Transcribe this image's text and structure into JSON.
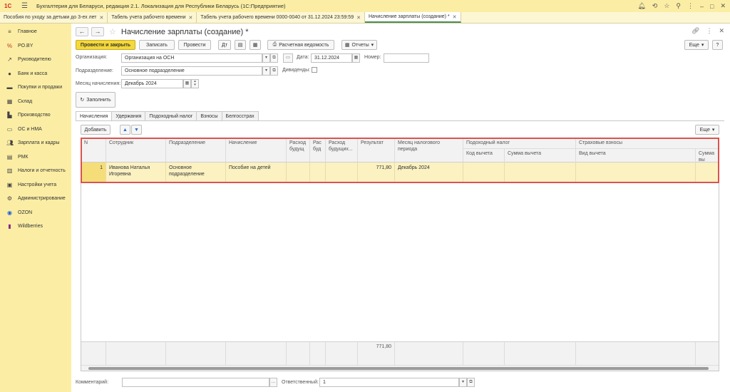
{
  "app_title": "Бухгалтерия для Беларуси, редакция 2.1. Локализация для Республики Беларусь   (1С:Предприятие)",
  "logo_text": "1С",
  "open_tabs": [
    {
      "label": "Пособия по уходу за детьми до 3-ех лет"
    },
    {
      "label": "Табель учета рабочего времени"
    },
    {
      "label": "Табель учета рабочего времени 0000-0040 от 31.12.2024 23:59:59"
    },
    {
      "label": "Начисление зарплаты (создание) *"
    }
  ],
  "sidebar": {
    "items": [
      {
        "label": "Главное",
        "icon": "menu-icon"
      },
      {
        "label": "PO.BY",
        "icon": "percent-icon"
      },
      {
        "label": "Руководителю",
        "icon": "trend-icon"
      },
      {
        "label": "Банк и касса",
        "icon": "bank-icon"
      },
      {
        "label": "Покупки и продажи",
        "icon": "cart-icon"
      },
      {
        "label": "Склад",
        "icon": "warehouse-icon"
      },
      {
        "label": "Производство",
        "icon": "factory-icon"
      },
      {
        "label": "ОС и НМА",
        "icon": "car-icon"
      },
      {
        "label": "Зарплата и кадры",
        "icon": "people-icon"
      },
      {
        "label": "РМК",
        "icon": "register-icon"
      },
      {
        "label": "Налоги и отчетность",
        "icon": "chart-icon"
      },
      {
        "label": "Настройки учета",
        "icon": "settings-doc-icon"
      },
      {
        "label": "Администрирование",
        "icon": "gear-icon"
      },
      {
        "label": "OZON",
        "icon": "ozon-icon"
      },
      {
        "label": "Wildberries",
        "icon": "wb-icon"
      }
    ]
  },
  "page": {
    "title": "Начисление зарплаты (создание) *"
  },
  "toolbar": {
    "post_close": "Провести и закрыть",
    "save": "Записать",
    "post": "Провести",
    "payroll": "Расчетная ведомость",
    "reports": "Отчеты",
    "more": "Еще"
  },
  "form": {
    "org_label": "Организация:",
    "org_value": "Организация на ОСН",
    "date_label": "Дата:",
    "date_value": "31.12.2024",
    "number_label": "Номер:",
    "number_value": "",
    "dept_label": "Подразделение:",
    "dept_value": "Основное подразделение",
    "dividends_label": "Дивиденды:",
    "month_label": "Месяц начисления:",
    "month_value": "Декабрь 2024",
    "fill_button": "Заполнить"
  },
  "form_tabs": [
    {
      "label": "Начисления"
    },
    {
      "label": "Удержания"
    },
    {
      "label": "Подоходный налог"
    },
    {
      "label": "Взносы"
    },
    {
      "label": "Белгосстрах"
    }
  ],
  "table_toolbar": {
    "add": "Добавить",
    "more": "Еще"
  },
  "table": {
    "columns": [
      "N",
      "Сотрудник",
      "Подразделение",
      "Начисление",
      "Расход\nбудущ",
      "Рас\nбуд",
      "Расход\nбудущих...",
      "Результат",
      "Месяц налогового периода"
    ],
    "group_tax": "Подоходный налог",
    "sub_tax_code": "Код вычета",
    "sub_tax_sum": "Сумма вычета",
    "group_ins": "Страховые взносы",
    "sub_ins_kind": "Вид вычета",
    "sub_ins_sum": "Сумма вы",
    "row": {
      "n": "1",
      "employee": "Иванова Наталья Игоревна",
      "dept": "Основное подразделение",
      "accrual": "Пособие на детей",
      "result": "771,80",
      "month": "Декабрь 2024"
    },
    "total": "771,80"
  },
  "footer": {
    "comment_label": "Комментарий:",
    "comment_value": "",
    "responsible_label": "Ответственный:",
    "responsible_value": "1"
  }
}
